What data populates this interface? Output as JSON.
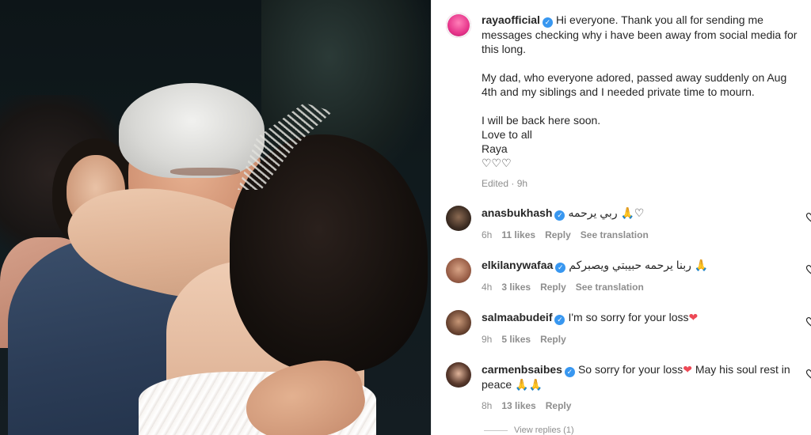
{
  "post": {
    "username": "rayaofficial",
    "caption_line1": "Hi everyone. Thank you all for sending me messages checking why i have been away from social media for this long.",
    "caption_line2": "My dad, who everyone adored, passed away suddenly on Aug 4th and my siblings and I needed private time to mourn.",
    "caption_line3": "I will be back here soon.",
    "caption_line4": "Love to all",
    "caption_line5": "Raya",
    "caption_hearts": "♡♡♡",
    "edited": "Edited",
    "time": "9h"
  },
  "comments": [
    {
      "username": "anasbukhash",
      "text": "ربي يرحمه 🙏♡",
      "time": "6h",
      "likes": "11 likes",
      "reply": "Reply",
      "translate": "See translation"
    },
    {
      "username": "elkilanywafaa",
      "text": "ربنا يرحمه حبيبتي ويصبركم 🙏",
      "time": "4h",
      "likes": "3 likes",
      "reply": "Reply",
      "translate": "See translation"
    },
    {
      "username": "salmaabudeif",
      "text": "I'm so sorry for your loss",
      "emoji": "❤",
      "time": "9h",
      "likes": "5 likes",
      "reply": "Reply"
    },
    {
      "username": "carmenbsaibes",
      "text_a": "So sorry for your loss",
      "emoji": "❤",
      "text_b": "May his soul rest in peace 🙏🙏",
      "time": "8h",
      "likes": "13 likes",
      "reply": "Reply"
    }
  ],
  "footer": {
    "view_replies": "View replies (1)"
  },
  "icons": {
    "verified": "verified-badge-icon",
    "like": "heart-outline-icon"
  },
  "colors": {
    "verified": "#3897f0",
    "meta": "#8e8e8e",
    "heart": "#ed4956"
  }
}
